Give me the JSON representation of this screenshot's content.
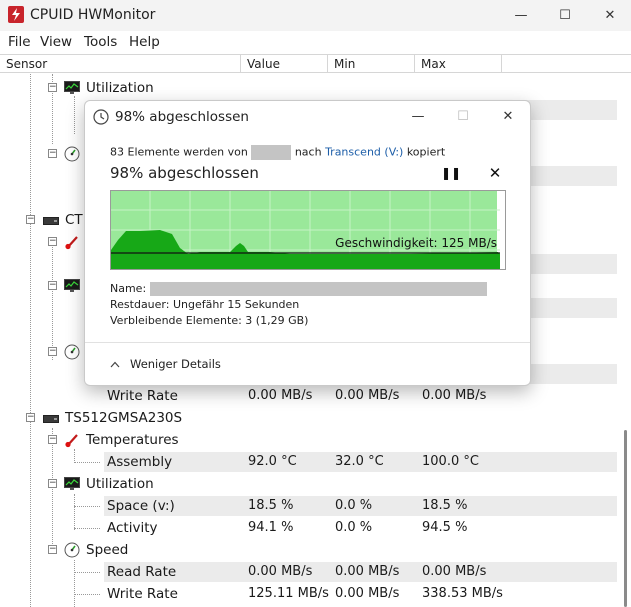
{
  "window": {
    "title": "CPUID HWMonitor",
    "minimize_glyph": "—",
    "maximize_glyph": "☐",
    "close_glyph": "✕"
  },
  "menu": [
    "File",
    "View",
    "Tools",
    "Help"
  ],
  "columns": [
    "Sensor",
    "Value",
    "Min",
    "Max"
  ],
  "tree": {
    "partial_utilization": "Utilization",
    "partial_device": "CT",
    "device2": {
      "write_rate_label": "Write Rate",
      "write_rate": [
        "0.00 MB/s",
        "0.00 MB/s",
        "0.00 MB/s"
      ]
    },
    "device3": {
      "name": "TS512GMSA230S",
      "temperatures_label": "Temperatures",
      "assembly_label": "Assembly",
      "assembly": [
        "92.0 °C",
        "32.0 °C",
        "100.0 °C"
      ],
      "utilization_label": "Utilization",
      "space_label": "Space (v:)",
      "space": [
        "18.5 %",
        "0.0 %",
        "18.5 %"
      ],
      "activity_label": "Activity",
      "activity": [
        "94.1 %",
        "0.0 %",
        "94.5 %"
      ],
      "speed_label": "Speed",
      "read_rate_label": "Read Rate",
      "read_rate": [
        "0.00 MB/s",
        "0.00 MB/s",
        "0.00 MB/s"
      ],
      "write_rate_label": "Write Rate",
      "write_rate": [
        "125.11 MB/s",
        "0.00 MB/s",
        "338.53 MB/s"
      ]
    }
  },
  "dialog": {
    "title": "98% abgeschlossen",
    "desc_prefix": "83 Elemente werden von",
    "desc_mid": "nach",
    "desc_target": "Transcend (V:)",
    "desc_suffix": "kopiert",
    "progress_title": "98% abgeschlossen",
    "speed_label": "Geschwindigkeit: 125 MB/s",
    "name_label": "Name:",
    "remaining_time": "Restdauer:  Ungefähr 15 Sekunden",
    "remaining_items": "Verbleibende Elemente:  3 (1,29 GB)",
    "details_toggle": "Weniger Details",
    "pause_glyph": "❚❚",
    "cancel_glyph": "✕",
    "progress_percent": 98
  }
}
